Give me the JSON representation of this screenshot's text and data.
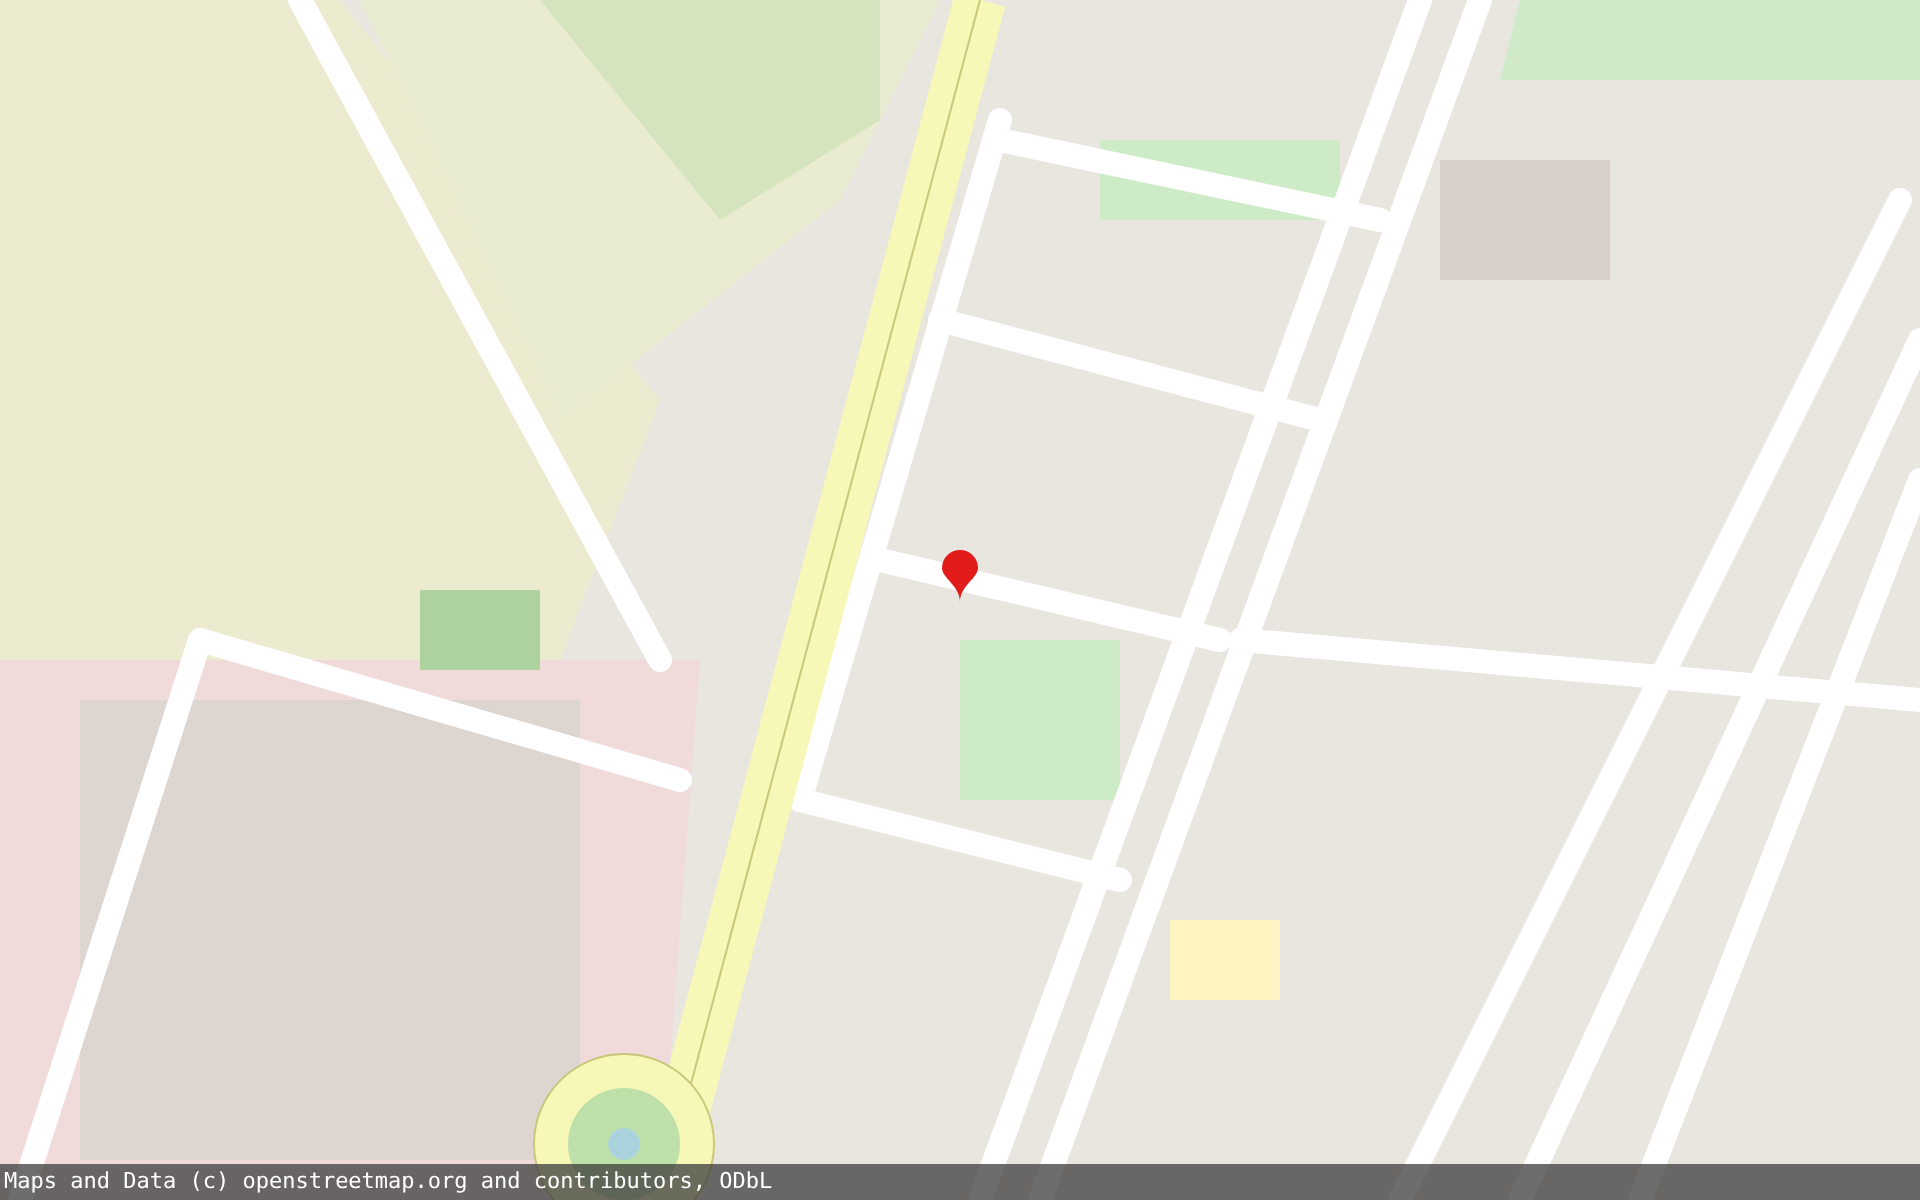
{
  "map": {
    "attribution": "Maps and Data (c) openstreetmap.org and contributors, ODbL"
  }
}
